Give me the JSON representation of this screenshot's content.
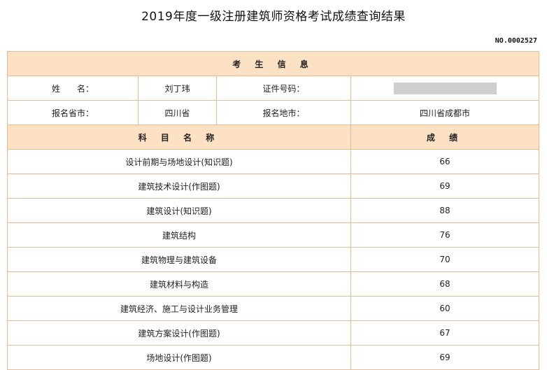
{
  "title": "2019年度一级注册建筑师资格考试成绩查询结果",
  "serial_no": "NO.0002527",
  "info_section": {
    "header": "考 生 信 息",
    "name_label": "姓　　名：",
    "name_value": "刘丁玮",
    "id_label": "证件号码：",
    "id_value_masked": true,
    "province_label": "报名省市：",
    "province_value": "四川省",
    "city_label": "报名地市：",
    "city_value": "四川省成都市"
  },
  "score_section": {
    "subject_header": "科 目 名 称",
    "score_header": "成 绩",
    "rows": [
      {
        "subject": "设计前期与场地设计(知识题)",
        "score": "66"
      },
      {
        "subject": "建筑技术设计(作图题)",
        "score": "69"
      },
      {
        "subject": "建筑设计(知识题)",
        "score": "88"
      },
      {
        "subject": "建筑结构",
        "score": "76"
      },
      {
        "subject": "建筑物理与建筑设备",
        "score": "70"
      },
      {
        "subject": "建筑材料与构造",
        "score": "68"
      },
      {
        "subject": "建筑经济、施工与设计业务管理",
        "score": "60"
      },
      {
        "subject": "建筑方案设计(作图题)",
        "score": "67"
      },
      {
        "subject": "场地设计(作图题)",
        "score": "69"
      }
    ]
  },
  "colors": {
    "header_bg": "#fde1c5",
    "border": "#f0b98e",
    "mask": "#cfcfcf"
  }
}
